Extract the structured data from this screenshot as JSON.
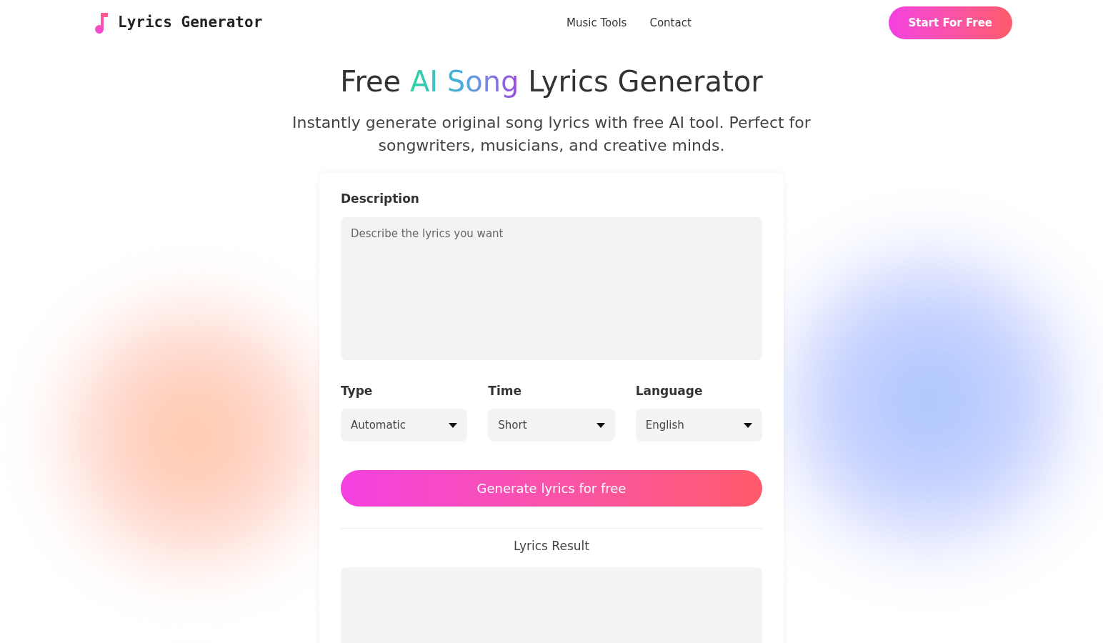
{
  "header": {
    "logo_text": "Lyrics Generator",
    "nav": [
      {
        "label": "Music Tools"
      },
      {
        "label": "Contact"
      }
    ],
    "cta": "Start For Free"
  },
  "hero": {
    "title_start": "Free",
    "title_highlight": "AI Song",
    "title_end": "Lyrics Generator",
    "subtitle": "Instantly generate original song lyrics with free AI tool. Perfect for songwriters, musicians, and creative minds."
  },
  "form": {
    "description_label": "Description",
    "description_placeholder": "Describe the lyrics you want",
    "selects": [
      {
        "label": "Type",
        "value": "Automatic"
      },
      {
        "label": "Time",
        "value": "Short"
      },
      {
        "label": "Language",
        "value": "English"
      }
    ],
    "generate_button": "Generate lyrics for free",
    "result_label": "Lyrics Result"
  }
}
